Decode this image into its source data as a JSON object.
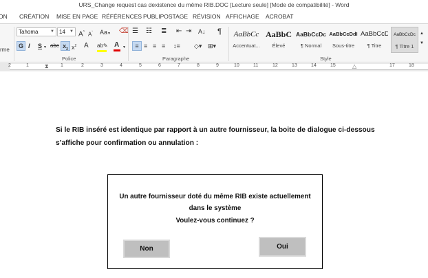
{
  "window": {
    "title": "URS_Change request cas dexistence du même RIB.DOC [Lecture seule] [Mode de compatibilité] - Word"
  },
  "menu": {
    "tabs": [
      "ON",
      "CRÉATION",
      "MISE EN PAGE",
      "RÉFÉRENCES",
      "PUBLIPOSTAGE",
      "RÉVISION",
      "AFFICHAGE",
      "ACROBAT"
    ]
  },
  "ribbon": {
    "left_fragment": "rme",
    "font": {
      "family": "Tahoma",
      "size": "14",
      "grow": "A",
      "shrink": "A",
      "case": "Aa",
      "bold": "G",
      "italic": "I",
      "underline": "S",
      "strike": "abc",
      "subscript": "x",
      "superscript": "x",
      "highlight_color": "#ffff00",
      "font_color": "#e00000",
      "group_label": "Police"
    },
    "paragraph": {
      "group_label": "Paragraphe",
      "pilcrow": "¶"
    },
    "styles": {
      "group_label": "Style",
      "items": [
        {
          "sample": "AaBbCc",
          "name": "Accentuat..."
        },
        {
          "sample": "AaBbC",
          "name": "Élevé"
        },
        {
          "sample": "AaBbCcDc",
          "name": "¶ Normal"
        },
        {
          "sample": "AaBbCcDdI",
          "name": "Sous-titre"
        },
        {
          "sample": "AaBbCcD",
          "name": "¶ Titre"
        },
        {
          "sample": "AaBbCcDc",
          "name": "¶ Titre 1"
        }
      ]
    }
  },
  "ruler": {
    "labels": [
      "2",
      "1",
      "1",
      "2",
      "3",
      "4",
      "5",
      "6",
      "7",
      "8",
      "9",
      "10",
      "11",
      "12",
      "13",
      "14",
      "15",
      "16",
      "17",
      "18"
    ]
  },
  "document": {
    "line1": "Si le RIB inséré est identique par rapport à un autre fournisseur, la boite de dialogue ci-dessous",
    "line2": "s’affiche pour confirmation ou annulation :",
    "dialog": {
      "line1": "Un autre fournisseur doté du même RIB existe actuellement",
      "line2": "dans le système",
      "line3": "Voulez-vous continuez ?",
      "no_label": "Non",
      "yes_label": "Oui"
    }
  }
}
